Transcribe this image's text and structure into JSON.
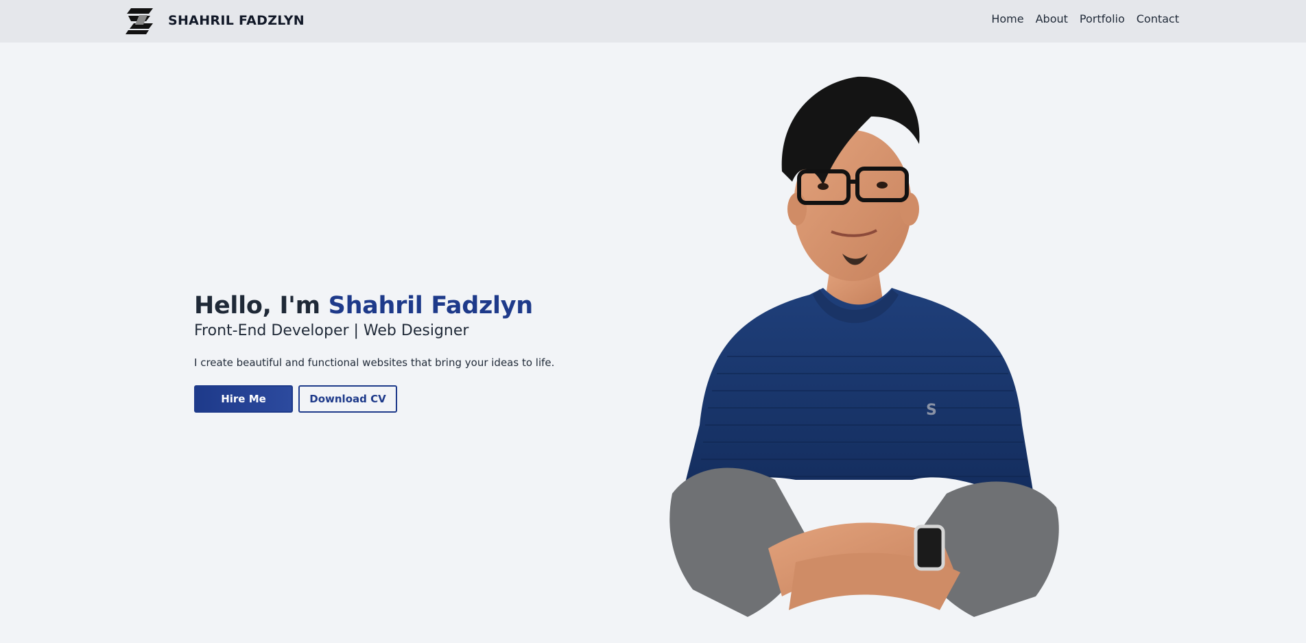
{
  "header": {
    "brand_name": "SHAHRIL FADZLYN",
    "logo_icon": "s-logo-icon",
    "nav": [
      {
        "label": "Home"
      },
      {
        "label": "About"
      },
      {
        "label": "Portfolio"
      },
      {
        "label": "Contact"
      }
    ]
  },
  "hero": {
    "greeting": "Hello, I'm ",
    "name": "Shahril Fadzlyn",
    "subtitle": "Front-End Developer | Web Designer",
    "description": "I create beautiful and functional websites that bring your ideas to life.",
    "buttons": {
      "primary_label": "Hire Me",
      "secondary_label": "Download CV"
    }
  },
  "colors": {
    "background": "#f2f4f7",
    "navbar": "#e5e7eb",
    "accent": "#1e3a8a",
    "text": "#1f2937"
  }
}
